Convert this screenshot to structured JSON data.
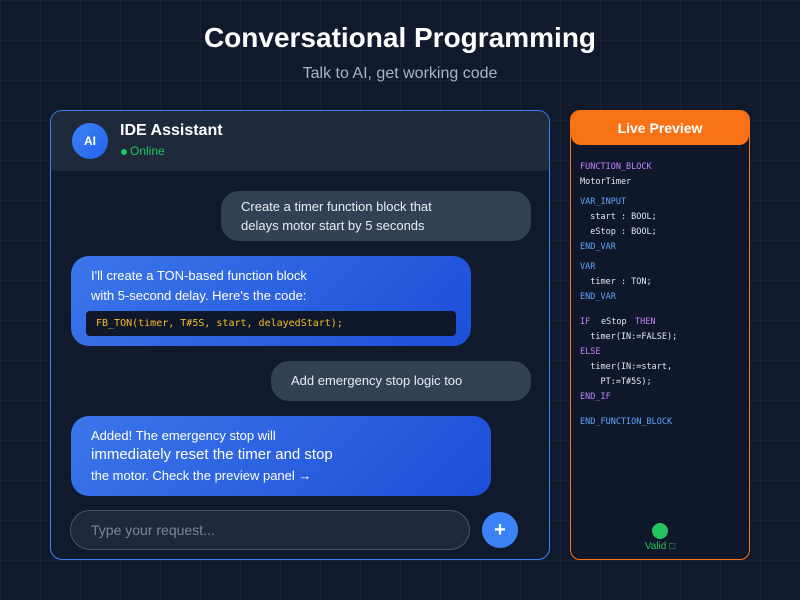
{
  "page": {
    "title": "Conversational Programming",
    "subtitle": "Talk to AI, get working code"
  },
  "chat": {
    "header": {
      "avatar_text": "AI",
      "name": "IDE Assistant",
      "status": "Online"
    },
    "messages": [
      {
        "role": "user",
        "lines": [
          "Create a timer function block that",
          "delays motor start by 5 seconds"
        ]
      },
      {
        "role": "assistant",
        "lines": [
          "I'll create a TON-based function block",
          "with 5-second delay. Here's the code:"
        ],
        "code": "FB_TON(timer, T#5S, start, delayedStart);"
      },
      {
        "role": "user",
        "lines": [
          "Add emergency stop logic too"
        ]
      },
      {
        "role": "assistant",
        "lines": [
          "Added! The emergency stop will",
          "immediately reset the timer and stop",
          "the motor. Check the preview panel →"
        ]
      }
    ],
    "input": {
      "placeholder": "Type your request...",
      "value": ""
    },
    "send_label": "+"
  },
  "preview": {
    "title": "Live Preview",
    "code_lines": [
      "FUNCTION_BLOCK",
      "MotorTimer",
      "VAR_INPUT",
      "  start : BOOL;",
      "  eStop : BOOL;",
      "END_VAR",
      "VAR",
      "  timer : TON;",
      "END_VAR",
      "IF",
      "eStop",
      "THEN",
      "  timer(IN:=FALSE);",
      "ELSE",
      "  timer(IN:=start,",
      "    PT:=T#5S);",
      "END_IF",
      "END_FUNCTION_BLOCK"
    ],
    "status": "Valid □"
  },
  "colors": {
    "background": "#101a2c",
    "chat_border": "#3b82f6",
    "user_bubble": "#334155",
    "ai_bubble": "#2563eb",
    "preview_accent": "#f97316",
    "success": "#22c55e",
    "keyword": "#c084fc",
    "section": "#60a5fa",
    "code_string": "#fbbf24"
  },
  "icons": {
    "send": "plus-icon",
    "status": "online-dot-icon",
    "valid": "valid-indicator-icon"
  }
}
